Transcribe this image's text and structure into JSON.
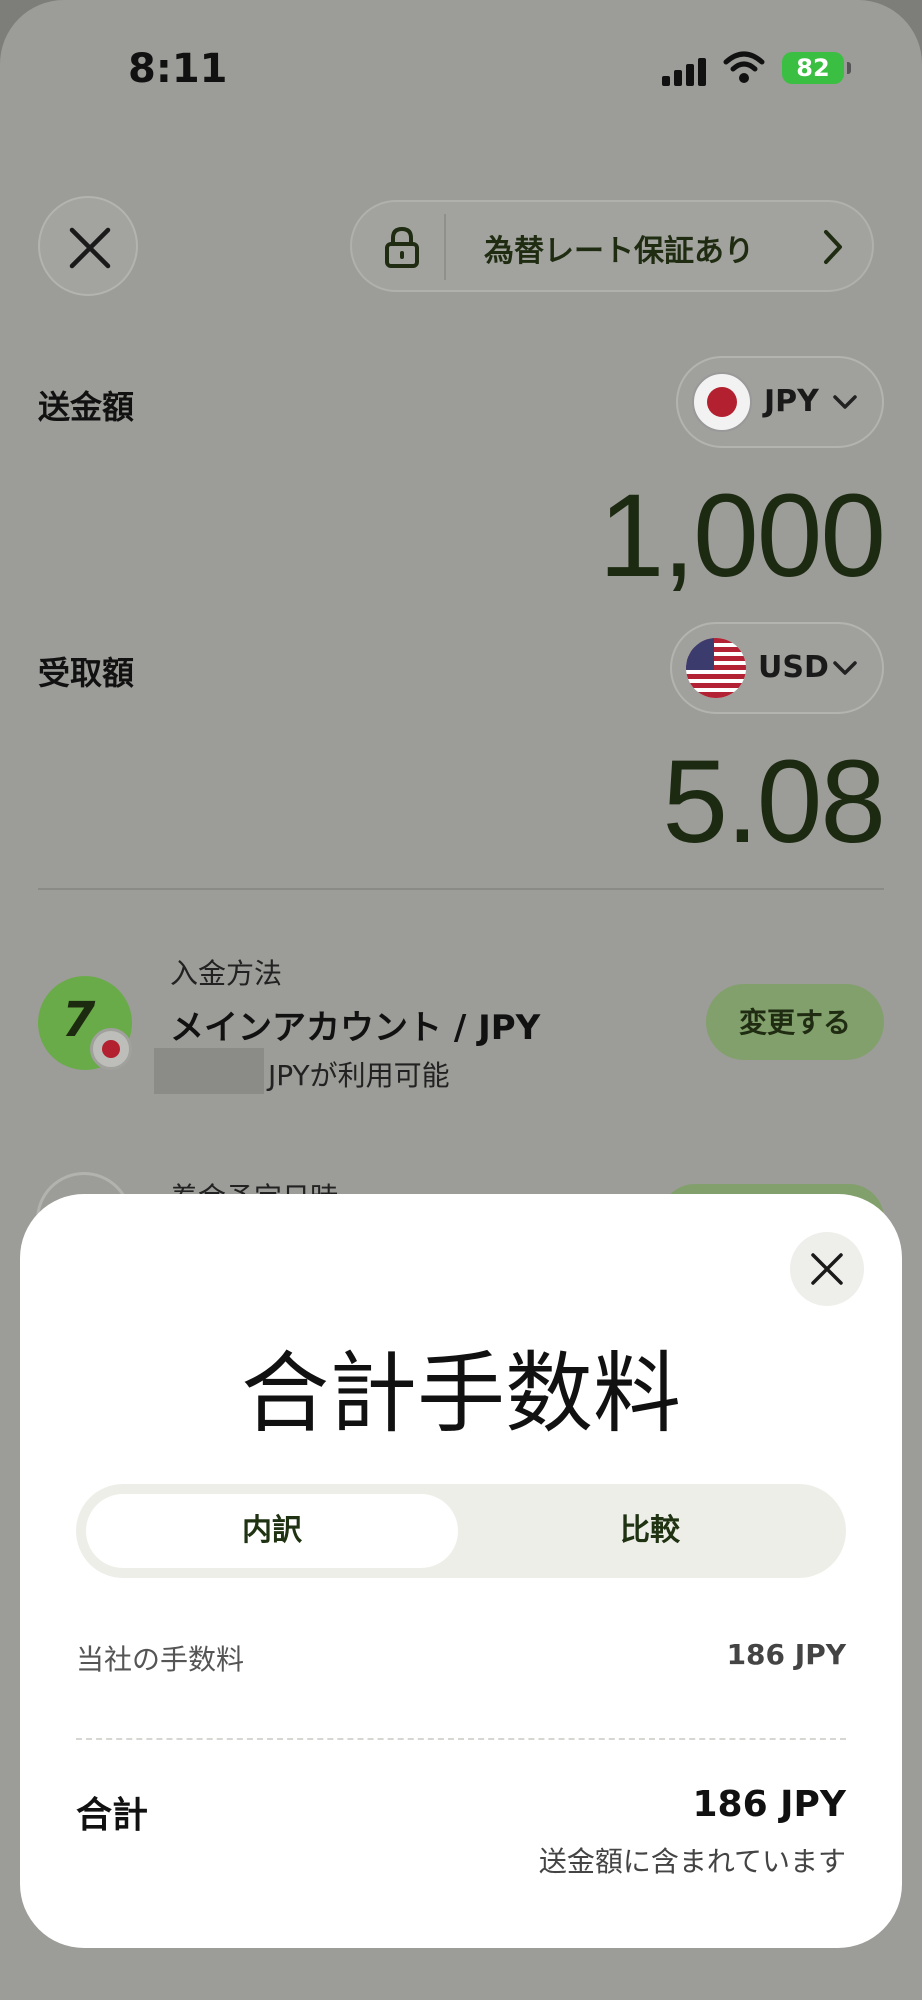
{
  "status_bar": {
    "time": "8:11",
    "battery": "82"
  },
  "header": {
    "close_icon": "close-icon",
    "rate_lock_label": "為替レート保証あり"
  },
  "send": {
    "label": "送金額",
    "currency": "JPY",
    "amount": "1,000"
  },
  "receive": {
    "label": "受取額",
    "currency": "USD",
    "amount": "5.08"
  },
  "payment_method": {
    "section_label": "入金方法",
    "title": "メインアカウント / JPY",
    "availability": "JPYが利用可能",
    "change_label": "変更する"
  },
  "next_row": {
    "label": "着金予定日時"
  },
  "fee_sheet": {
    "title": "合計手数料",
    "tabs": [
      {
        "label": "内訳",
        "active": true
      },
      {
        "label": "比較",
        "active": false
      }
    ],
    "fee_label": "当社の手数料",
    "fee_value": "186 JPY",
    "total_label": "合計",
    "total_value": "186 JPY",
    "total_note": "送金額に含まれています"
  },
  "colors": {
    "accent_green": "#6aab49",
    "dark_green_text": "#1d2a12",
    "battery_green": "#3bbf43"
  }
}
